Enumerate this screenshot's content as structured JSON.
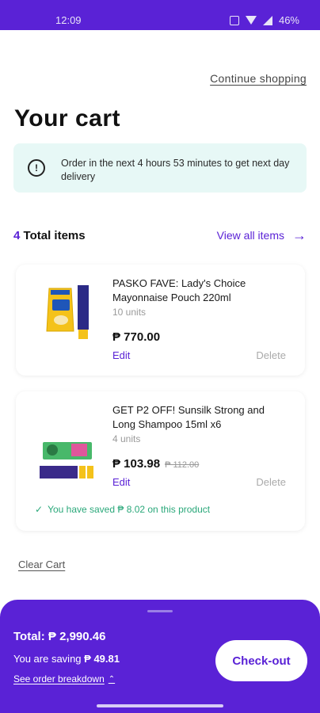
{
  "status_bar": {
    "time": "12:09",
    "battery": "46%"
  },
  "header": {
    "continue_label": "Continue shopping"
  },
  "page": {
    "title": "Your cart"
  },
  "notice": {
    "icon": "info-icon",
    "text": "Order in the next 4 hours 53 minutes to get next day delivery"
  },
  "items_header": {
    "count": "4",
    "count_label": "Total items",
    "view_all_label": "View all items"
  },
  "cart_items": [
    {
      "name": "PASKO FAVE: Lady's Choice Mayonnaise Pouch 220ml",
      "units": "10 units",
      "price": "₱ 770.00",
      "edit_label": "Edit",
      "delete_label": "Delete"
    },
    {
      "name": "GET P2 OFF! Sunsilk Strong and Long Shampoo 15ml x6",
      "units": "4 units",
      "price": "₱ 103.98",
      "old_price": "₱ 112.00",
      "edit_label": "Edit",
      "delete_label": "Delete",
      "saved_text": "You have saved ₱ 8.02 on this product"
    }
  ],
  "clear_cart_label": "Clear Cart",
  "summary": {
    "total_label": "Total:",
    "total_value": "₱ 2,990.46",
    "saving_label": "You are saving",
    "saving_value": "₱ 49.81",
    "breakdown_label": "See order breakdown",
    "checkout_label": "Check-out"
  },
  "colors": {
    "brand": "#5a22d6",
    "notice_bg": "#e7f8f6",
    "saved_green": "#2aa87a"
  }
}
